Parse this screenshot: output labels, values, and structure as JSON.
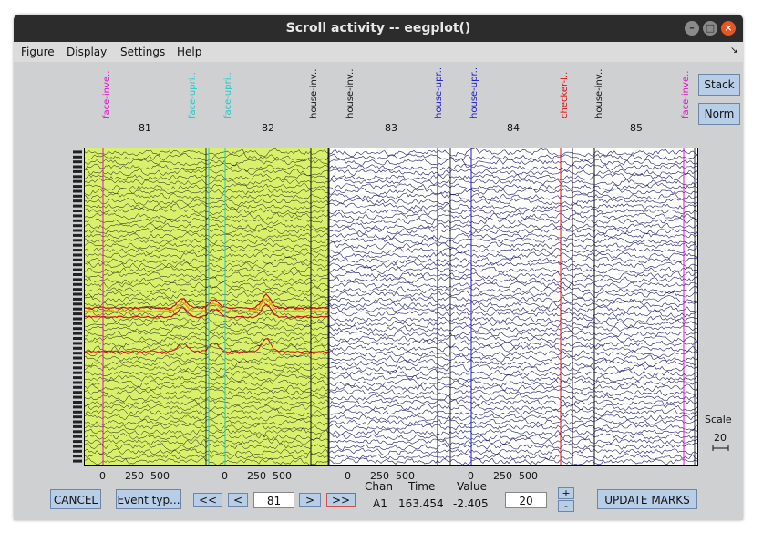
{
  "window": {
    "title": "Scroll activity -- eegplot()"
  },
  "menu": [
    "Figure",
    "Display",
    "Settings",
    "Help"
  ],
  "side_buttons": {
    "stack": "Stack",
    "norm": "Norm"
  },
  "epochs": [
    "81",
    "82",
    "83",
    "84",
    "85"
  ],
  "events": [
    {
      "label": "face-inve..",
      "color": "#e010c8"
    },
    {
      "label": "face-upri..",
      "color": "#20c8c8"
    },
    {
      "label": "face-upri..",
      "color": "#20c8c8"
    },
    {
      "label": "house-inv..",
      "color": "#111111"
    },
    {
      "label": "house-inv..",
      "color": "#111111"
    },
    {
      "label": "house-upr..",
      "color": "#1a1ad0"
    },
    {
      "label": "house-upr..",
      "color": "#1a1ad0"
    },
    {
      "label": "checker-l..",
      "color": "#e01010"
    },
    {
      "label": "house-inv..",
      "color": "#111111"
    },
    {
      "label": "face-inve..",
      "color": "#e010c8"
    }
  ],
  "xticks": [
    [
      "0",
      "250",
      "500"
    ],
    [
      "0",
      "250",
      "500"
    ],
    [
      "0",
      "250",
      "500"
    ],
    [
      "0",
      "250",
      "500"
    ]
  ],
  "scale": {
    "label": "Scale",
    "value": "20"
  },
  "controls": {
    "cancel": "CANCEL",
    "event_type": "Event typ...",
    "prev_prev": "<<",
    "prev": "<",
    "epoch_value": "81",
    "next": ">",
    "next_next": ">>",
    "chan_header": "Chan",
    "time_header": "Time",
    "value_header": "Value",
    "chan": "A1",
    "time": "163.454",
    "value": "-2.405",
    "scale_value": "20",
    "plus": "+",
    "minus": "-",
    "update_marks": "UPDATE MARKS"
  },
  "colors": {
    "trace": "#1c1c6e",
    "highlight_bg": "#d8f06c",
    "highlight_trace": "#111111",
    "erp_red": "#d01010",
    "erp_orange": "#f0a010"
  }
}
